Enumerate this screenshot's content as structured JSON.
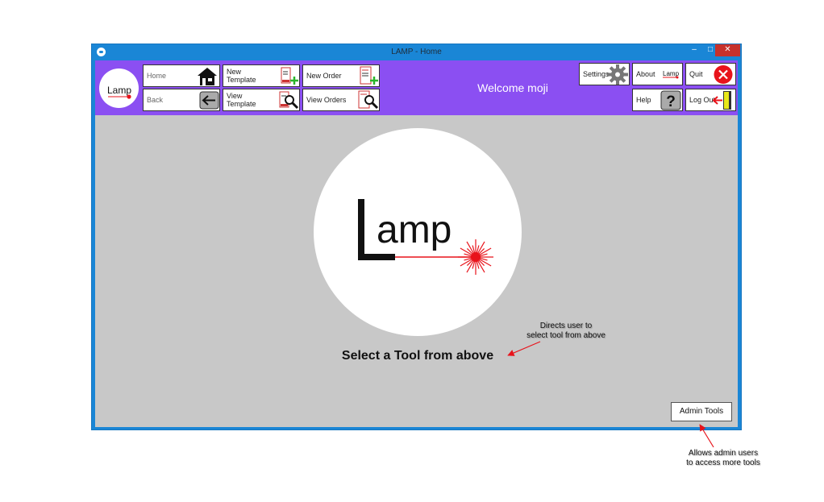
{
  "window": {
    "title": "LAMP - Home",
    "controls": {
      "minimize": "–",
      "maximize": "□",
      "close": "✕"
    }
  },
  "app_logo": {
    "text": "Lamp"
  },
  "toolbar": {
    "home_label": "Home",
    "back_label": "Back",
    "new_template_label": "New\nTemplate",
    "view_template_label": "View\nTemplate",
    "new_order_label": "New Order",
    "view_orders_label": "View Orders",
    "settings_label": "Settings",
    "about_label": "About",
    "about_logo_text": "Lamp",
    "quit_label": "Quit",
    "help_label": "Help",
    "logout_label": "Log Out"
  },
  "welcome": "Welcome moji",
  "main": {
    "logo_text": "amp",
    "instruction": "Select a Tool from above",
    "admin_tools_label": "Admin Tools"
  },
  "annotations": {
    "select_tool_note": "Directs user to\nselect tool from above",
    "admin_note": "Allows admin users\nto access more tools"
  },
  "colors": {
    "toolbar_bg": "#8b4ff2",
    "window_border": "#1a86d6",
    "content_bg": "#c8c8c8",
    "laser_red": "#e8131b"
  }
}
